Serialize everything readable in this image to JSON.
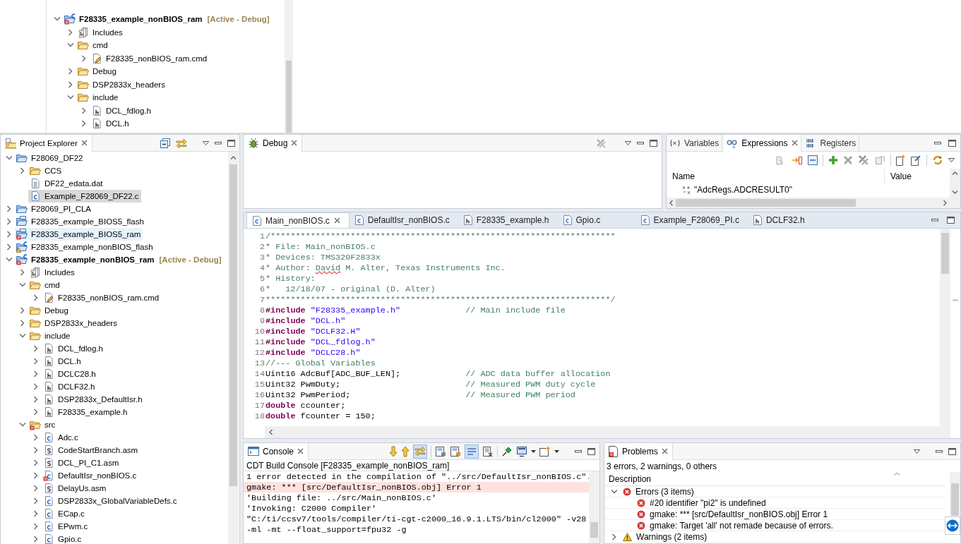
{
  "outline_snippet": {
    "tree": [
      {
        "label": "F28335_example_nonBIOS_ram",
        "annotation": "[Active - Debug]",
        "kind": "cproject",
        "error": true,
        "expanded": true,
        "selected": false,
        "children": [
          {
            "label": "Includes",
            "kind": "includes",
            "expanded": false,
            "selected": false
          },
          {
            "label": "cmd",
            "kind": "folder",
            "expanded": true,
            "selected": false,
            "children": [
              {
                "label": "F28335_nonBIOS_ram.cmd",
                "kind": "cmd",
                "expanded": false,
                "selected": false
              }
            ]
          },
          {
            "label": "Debug",
            "kind": "folder",
            "expanded": false,
            "selected": false
          },
          {
            "label": "DSP2833x_headers",
            "kind": "folder",
            "expanded": false,
            "selected": false
          },
          {
            "label": "include",
            "kind": "folder",
            "expanded": true,
            "selected": false,
            "children": [
              {
                "label": "DCL_fdlog.h",
                "kind": "h",
                "expanded": false,
                "selected": false
              },
              {
                "label": "DCL.h",
                "kind": "h",
                "expanded": false,
                "selected": false
              }
            ]
          }
        ]
      }
    ]
  },
  "project_explorer": {
    "tab": {
      "label": "Project Explorer",
      "selected": true
    },
    "tree": [
      {
        "label": "F28069_DF22",
        "kind": "project",
        "expanded": true,
        "selected": false,
        "hovered": false,
        "children": [
          {
            "label": "CCS",
            "kind": "folder",
            "expanded": false,
            "selected": false,
            "hovered": false
          },
          {
            "label": "DF22_edata.dat",
            "kind": "dat",
            "selected": false,
            "hovered": false
          },
          {
            "label": "Example_F28069_DF22.c",
            "kind": "c",
            "selected": true,
            "hovered": false
          }
        ]
      },
      {
        "label": "F28069_PI_CLA",
        "kind": "project",
        "expanded": false,
        "selected": false,
        "hovered": false
      },
      {
        "label": "F28335_example_BIOS5_flash",
        "kind": "rtsc",
        "expanded": false,
        "selected": false,
        "hovered": false
      },
      {
        "label": "F28335_example_BIOS5_ram",
        "kind": "rtsc",
        "error": true,
        "expanded": false,
        "selected": false,
        "hovered": true
      },
      {
        "label": "F28335_example_nonBIOS_flash",
        "kind": "cproject",
        "warning": true,
        "expanded": false,
        "selected": false,
        "hovered": false
      },
      {
        "label": "F28335_example_nonBIOS_ram",
        "annotation": "[Active - Debug]",
        "kind": "cproject",
        "error": true,
        "expanded": true,
        "selected": false,
        "hovered": false,
        "children": [
          {
            "label": "Includes",
            "kind": "includes",
            "expanded": false,
            "selected": false,
            "hovered": false
          },
          {
            "label": "cmd",
            "kind": "folder",
            "expanded": true,
            "selected": false,
            "hovered": false,
            "children": [
              {
                "label": "F28335_nonBIOS_ram.cmd",
                "kind": "cmd",
                "expanded": false,
                "selected": false,
                "hovered": false
              }
            ]
          },
          {
            "label": "Debug",
            "kind": "folder",
            "expanded": false,
            "selected": false,
            "hovered": false
          },
          {
            "label": "DSP2833x_headers",
            "kind": "folder",
            "expanded": false,
            "selected": false,
            "hovered": false
          },
          {
            "label": "include",
            "kind": "folder",
            "expanded": true,
            "selected": false,
            "hovered": false,
            "children": [
              {
                "label": "DCL_fdlog.h",
                "kind": "h",
                "expanded": false,
                "selected": false,
                "hovered": false
              },
              {
                "label": "DCL.h",
                "kind": "h",
                "expanded": false,
                "selected": false,
                "hovered": false
              },
              {
                "label": "DCLC28.h",
                "kind": "h",
                "expanded": false,
                "selected": false,
                "hovered": false
              },
              {
                "label": "DCLF32.h",
                "kind": "h",
                "expanded": false,
                "selected": false,
                "hovered": false
              },
              {
                "label": "DSP2833x_DefaultIsr.h",
                "kind": "h",
                "expanded": false,
                "selected": false,
                "hovered": false
              },
              {
                "label": "F28335_example.h",
                "kind": "h",
                "expanded": false,
                "selected": false,
                "hovered": false
              }
            ]
          },
          {
            "label": "src",
            "kind": "folder",
            "error": true,
            "expanded": true,
            "selected": false,
            "hovered": false,
            "children": [
              {
                "label": "Adc.c",
                "kind": "c",
                "expanded": false,
                "selected": false,
                "hovered": false
              },
              {
                "label": "CodeStartBranch.asm",
                "kind": "asm",
                "expanded": false,
                "selected": false,
                "hovered": false
              },
              {
                "label": "DCL_PI_C1.asm",
                "kind": "asm",
                "expanded": false,
                "selected": false,
                "hovered": false
              },
              {
                "label": "DefaultIsr_nonBIOS.c",
                "kind": "c",
                "error": true,
                "expanded": false,
                "selected": false,
                "hovered": false
              },
              {
                "label": "DelayUs.asm",
                "kind": "asm",
                "expanded": false,
                "selected": false,
                "hovered": false
              },
              {
                "label": "DSP2833x_GlobalVariableDefs.c",
                "kind": "c",
                "expanded": false,
                "selected": false,
                "hovered": false
              },
              {
                "label": "ECap.c",
                "kind": "c",
                "expanded": false,
                "selected": false,
                "hovered": false
              },
              {
                "label": "EPwm.c",
                "kind": "c",
                "expanded": false,
                "selected": false,
                "hovered": false
              },
              {
                "label": "Gpio.c",
                "kind": "c",
                "expanded": false,
                "selected": false,
                "hovered": false
              }
            ]
          }
        ]
      }
    ]
  },
  "debug": {
    "tab": {
      "label": "Debug",
      "selected": true
    }
  },
  "expressions_view": {
    "tabs": [
      {
        "label": "Variables",
        "kind": "variables",
        "selected": false
      },
      {
        "label": "Expressions",
        "kind": "expressions",
        "selected": true
      },
      {
        "label": "Registers",
        "kind": "registers",
        "selected": false
      }
    ],
    "columns": [
      "Name",
      "Value"
    ],
    "rows": [
      {
        "name": "\"AdcRegs.ADCRESULT0\""
      }
    ]
  },
  "editor": {
    "tabs": [
      {
        "label": "Main_nonBIOS.c",
        "kind": "c",
        "selected": true
      },
      {
        "label": "DefaultIsr_nonBIOS.c",
        "kind": "c",
        "selected": false
      },
      {
        "label": "F28335_example.h",
        "kind": "h",
        "selected": false
      },
      {
        "label": "Gpio.c",
        "kind": "c",
        "selected": false
      },
      {
        "label": "Example_F28069_PI.c",
        "kind": "c",
        "selected": false
      },
      {
        "label": "DCLF32.h",
        "kind": "h",
        "selected": false
      }
    ],
    "lines": [
      {
        "number": "1",
        "segments": [
          {
            "kind": "comment",
            "text": "/*********************************************************************"
          }
        ]
      },
      {
        "number": "2",
        "segments": [
          {
            "kind": "comment",
            "text": "* File: Main_nonBIOS.c"
          }
        ]
      },
      {
        "number": "3",
        "segments": [
          {
            "kind": "comment",
            "text": "* Devices: TMS320F2833x"
          }
        ]
      },
      {
        "number": "4",
        "segments": [
          {
            "kind": "comment",
            "text": "* Author: "
          },
          {
            "kind": "comment",
            "text": "David",
            "misspelled": true
          },
          {
            "kind": "comment",
            "text": " M. Alter, Texas Instruments Inc."
          }
        ]
      },
      {
        "number": "5",
        "segments": [
          {
            "kind": "comment",
            "text": "* History:"
          }
        ]
      },
      {
        "number": "6",
        "segments": [
          {
            "kind": "comment",
            "text": "*   12/18/07 - original (D. Alter)"
          }
        ]
      },
      {
        "number": "7",
        "segments": [
          {
            "kind": "comment",
            "text": "*********************************************************************/"
          }
        ]
      },
      {
        "number": "8",
        "segments": [
          {
            "kind": "keyword",
            "text": "#include"
          },
          {
            "kind": "string",
            "text": " \"F28335_example.h\"             "
          },
          {
            "kind": "comment",
            "text": "// Main include file"
          }
        ]
      },
      {
        "number": "9",
        "segments": [
          {
            "kind": "keyword",
            "text": "#include"
          },
          {
            "kind": "string",
            "text": " \"DCL.h\""
          }
        ]
      },
      {
        "number": "10",
        "segments": [
          {
            "kind": "keyword",
            "text": "#include"
          },
          {
            "kind": "string",
            "text": " \"DCLF32.H\""
          }
        ]
      },
      {
        "number": "11",
        "segments": [
          {
            "kind": "keyword",
            "text": "#include"
          },
          {
            "kind": "string",
            "text": " \"DCL_fdlog.h\""
          }
        ]
      },
      {
        "number": "12",
        "segments": [
          {
            "kind": "keyword",
            "text": "#include"
          },
          {
            "kind": "string",
            "text": " \"DCLC28.h\""
          }
        ]
      },
      {
        "number": "13",
        "segments": [
          {
            "kind": "comment",
            "text": "//--- Global Variables"
          }
        ]
      },
      {
        "number": "14",
        "segments": [
          {
            "kind": "plain",
            "text": "Uint16 AdcBuf[ADC_BUF_LEN];             "
          },
          {
            "kind": "comment",
            "text": "// ADC data buffer allocation"
          }
        ]
      },
      {
        "number": "15",
        "segments": [
          {
            "kind": "plain",
            "text": "Uint32 PwmDuty;                         "
          },
          {
            "kind": "comment",
            "text": "// Measured PWM duty cycle"
          }
        ]
      },
      {
        "number": "16",
        "segments": [
          {
            "kind": "plain",
            "text": "Uint32 PwmPeriod;                       "
          },
          {
            "kind": "comment",
            "text": "// Measured PWM period"
          }
        ]
      },
      {
        "number": "17",
        "segments": [
          {
            "kind": "keyword",
            "text": "double"
          },
          {
            "kind": "plain",
            "text": " ccounter;"
          }
        ]
      },
      {
        "number": "18",
        "segments": [
          {
            "kind": "keyword",
            "text": "double"
          },
          {
            "kind": "plain",
            "text": " fcounter = 150;"
          }
        ]
      }
    ]
  },
  "console": {
    "tab": {
      "label": "Console",
      "selected": true
    },
    "scroll_lock": true,
    "word_wrap": true,
    "subtitle": "CDT Build Console [F28335_example_nonBIOS_ram]",
    "lines": [
      {
        "text": "1 error detected in the compilation of \"../src/DefaultIsr_nonBIOS.c\".",
        "error": false
      },
      {
        "text": "gmake: *** [src/DefaultIsr_nonBIOS.obj] Error 1",
        "error": true
      },
      {
        "text": "'Building file: ../src/Main_nonBIOS.c'",
        "error": false
      },
      {
        "text": "'Invoking: C2000 Compiler'",
        "error": false
      },
      {
        "text": "\"C:/ti/ccsv7/tools/compiler/ti-cgt-c2000_16.9.1.LTS/bin/cl2000\" -v28",
        "error": false
      },
      {
        "text": "-ml -mt --float_support=fpu32 -g",
        "error": false
      }
    ]
  },
  "problems": {
    "tab": {
      "label": "Problems",
      "selected": true
    },
    "summary": "3 errors, 2 warnings, 0 others",
    "column": "Description",
    "groups": [
      {
        "label": "Errors (3 items)",
        "kind": "error",
        "expanded": true,
        "items": [
          {
            "text": "#20 identifier \"pi2\" is undefined",
            "kind": "error"
          },
          {
            "text": "gmake: *** [src/DefaultIsr_nonBIOS.obj] Error 1",
            "kind": "error"
          },
          {
            "text": "gmake: Target 'all' not remade because of errors.",
            "kind": "error"
          }
        ]
      },
      {
        "label": "Warnings (2 items)",
        "kind": "warning",
        "expanded": false
      }
    ]
  }
}
